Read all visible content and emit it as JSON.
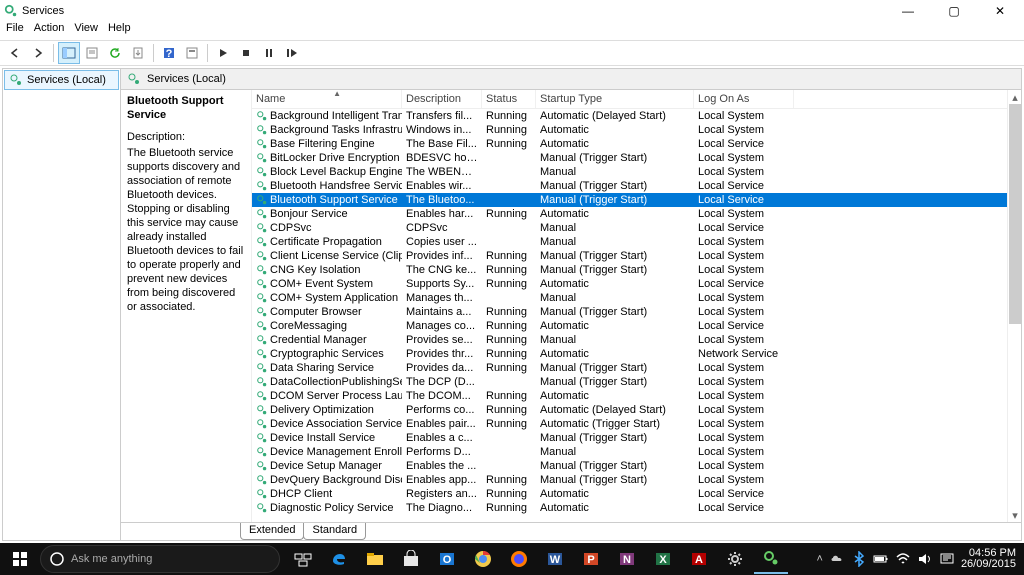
{
  "window": {
    "title": "Services"
  },
  "menubar": [
    "File",
    "Action",
    "View",
    "Help"
  ],
  "tree": {
    "root": "Services (Local)"
  },
  "pane_header": "Services (Local)",
  "detail": {
    "name": "Bluetooth Support Service",
    "label": "Description:",
    "description": "The Bluetooth service supports discovery and association of remote Bluetooth devices.  Stopping or disabling this service may cause already installed Bluetooth devices to fail to operate properly and prevent new devices from being discovered or associated."
  },
  "columns": {
    "name": "Name",
    "desc": "Description",
    "status": "Status",
    "startup": "Startup Type",
    "logon": "Log On As"
  },
  "tabs": {
    "extended": "Extended",
    "standard": "Standard"
  },
  "search": {
    "placeholder": "Ask me anything"
  },
  "clock": {
    "time": "04:56 PM",
    "date": "26/09/2015"
  },
  "rows": [
    {
      "n": "Background Intelligent Tran...",
      "d": "Transfers fil...",
      "s": "Running",
      "t": "Automatic (Delayed Start)",
      "l": "Local System"
    },
    {
      "n": "Background Tasks Infrastru...",
      "d": "Windows in...",
      "s": "Running",
      "t": "Automatic",
      "l": "Local System"
    },
    {
      "n": "Base Filtering Engine",
      "d": "The Base Fil...",
      "s": "Running",
      "t": "Automatic",
      "l": "Local Service"
    },
    {
      "n": "BitLocker Drive Encryption ...",
      "d": "BDESVC hos...",
      "s": "",
      "t": "Manual (Trigger Start)",
      "l": "Local System"
    },
    {
      "n": "Block Level Backup Engine ...",
      "d": "The WBENG...",
      "s": "",
      "t": "Manual",
      "l": "Local System"
    },
    {
      "n": "Bluetooth Handsfree Service",
      "d": "Enables wir...",
      "s": "",
      "t": "Manual (Trigger Start)",
      "l": "Local Service"
    },
    {
      "n": "Bluetooth Support Service",
      "d": "The Bluetoo...",
      "s": "",
      "t": "Manual (Trigger Start)",
      "l": "Local Service",
      "sel": true
    },
    {
      "n": "Bonjour Service",
      "d": "Enables har...",
      "s": "Running",
      "t": "Automatic",
      "l": "Local System"
    },
    {
      "n": "CDPSvc",
      "d": "CDPSvc",
      "s": "",
      "t": "Manual",
      "l": "Local Service"
    },
    {
      "n": "Certificate Propagation",
      "d": "Copies user ...",
      "s": "",
      "t": "Manual",
      "l": "Local System"
    },
    {
      "n": "Client License Service (ClipS...",
      "d": "Provides inf...",
      "s": "Running",
      "t": "Manual (Trigger Start)",
      "l": "Local System"
    },
    {
      "n": "CNG Key Isolation",
      "d": "The CNG ke...",
      "s": "Running",
      "t": "Manual (Trigger Start)",
      "l": "Local System"
    },
    {
      "n": "COM+ Event System",
      "d": "Supports Sy...",
      "s": "Running",
      "t": "Automatic",
      "l": "Local Service"
    },
    {
      "n": "COM+ System Application",
      "d": "Manages th...",
      "s": "",
      "t": "Manual",
      "l": "Local System"
    },
    {
      "n": "Computer Browser",
      "d": "Maintains a...",
      "s": "Running",
      "t": "Manual (Trigger Start)",
      "l": "Local System"
    },
    {
      "n": "CoreMessaging",
      "d": "Manages co...",
      "s": "Running",
      "t": "Automatic",
      "l": "Local Service"
    },
    {
      "n": "Credential Manager",
      "d": "Provides se...",
      "s": "Running",
      "t": "Manual",
      "l": "Local System"
    },
    {
      "n": "Cryptographic Services",
      "d": "Provides thr...",
      "s": "Running",
      "t": "Automatic",
      "l": "Network Service"
    },
    {
      "n": "Data Sharing Service",
      "d": "Provides da...",
      "s": "Running",
      "t": "Manual (Trigger Start)",
      "l": "Local System"
    },
    {
      "n": "DataCollectionPublishingSe...",
      "d": "The DCP (D...",
      "s": "",
      "t": "Manual (Trigger Start)",
      "l": "Local System"
    },
    {
      "n": "DCOM Server Process Laun...",
      "d": "The DCOM...",
      "s": "Running",
      "t": "Automatic",
      "l": "Local System"
    },
    {
      "n": "Delivery Optimization",
      "d": "Performs co...",
      "s": "Running",
      "t": "Automatic (Delayed Start)",
      "l": "Local System"
    },
    {
      "n": "Device Association Service",
      "d": "Enables pair...",
      "s": "Running",
      "t": "Automatic (Trigger Start)",
      "l": "Local System"
    },
    {
      "n": "Device Install Service",
      "d": "Enables a c...",
      "s": "",
      "t": "Manual (Trigger Start)",
      "l": "Local System"
    },
    {
      "n": "Device Management Enroll...",
      "d": "Performs D...",
      "s": "",
      "t": "Manual",
      "l": "Local System"
    },
    {
      "n": "Device Setup Manager",
      "d": "Enables the ...",
      "s": "",
      "t": "Manual (Trigger Start)",
      "l": "Local System"
    },
    {
      "n": "DevQuery Background Disc...",
      "d": "Enables app...",
      "s": "Running",
      "t": "Manual (Trigger Start)",
      "l": "Local System"
    },
    {
      "n": "DHCP Client",
      "d": "Registers an...",
      "s": "Running",
      "t": "Automatic",
      "l": "Local Service"
    },
    {
      "n": "Diagnostic Policy Service",
      "d": "The Diagno...",
      "s": "Running",
      "t": "Automatic",
      "l": "Local Service"
    }
  ]
}
